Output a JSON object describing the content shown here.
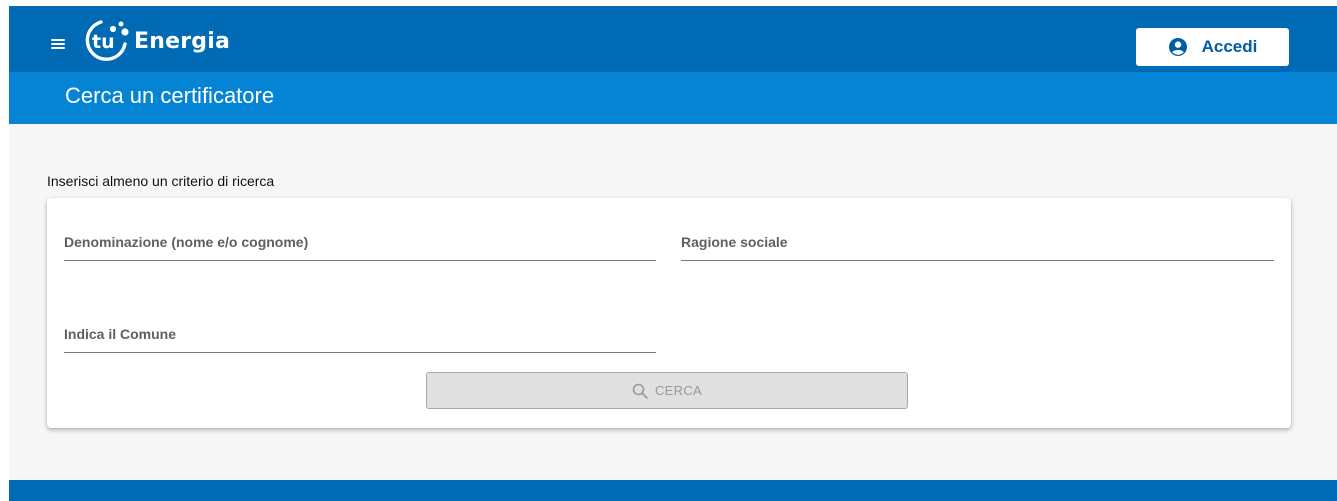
{
  "header": {
    "brand_name": "Energia",
    "logo_text": "tu",
    "login_label": "Accedi",
    "menu_icon": "hamburger-menu-icon",
    "login_icon": "user-circle-icon"
  },
  "title_bar": {
    "title": "Cerca un certificatore"
  },
  "search": {
    "instructions": "Inserisci almeno un criterio di ricerca",
    "fields": [
      {
        "label": "Denominazione (nome e/o cognome)",
        "value": ""
      },
      {
        "label": "Ragione sociale",
        "value": ""
      },
      {
        "label": "Indica il Comune",
        "value": ""
      }
    ],
    "button_label": "CERCA",
    "button_icon": "search-icon",
    "button_disabled": true
  },
  "colors": {
    "header_bg": "#006bb4",
    "title_bar_bg": "#0583d5",
    "page_bg": "#f6f6f6",
    "accent_text": "#005ea5",
    "disabled_button_bg": "#e0e0e0"
  }
}
